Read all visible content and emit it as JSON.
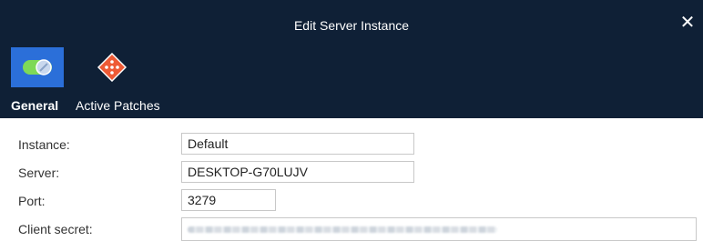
{
  "window": {
    "title": "Edit Server Instance",
    "close_label": "✕"
  },
  "tabs": [
    {
      "label": "General",
      "icon": "toggle-icon",
      "active": true
    },
    {
      "label": "Active Patches",
      "icon": "patch-diamond-icon",
      "active": false
    }
  ],
  "form": {
    "instance": {
      "label": "Instance:",
      "value": "Default"
    },
    "server": {
      "label": "Server:",
      "value": "DESKTOP-G70LUJV"
    },
    "port": {
      "label": "Port:",
      "value": "3279"
    },
    "client_secret": {
      "label": "Client secret:"
    }
  },
  "colors": {
    "header_bg": "#0f2036",
    "active_tab_bg": "#2b6fd9",
    "patch_icon": "#ee5a35"
  }
}
